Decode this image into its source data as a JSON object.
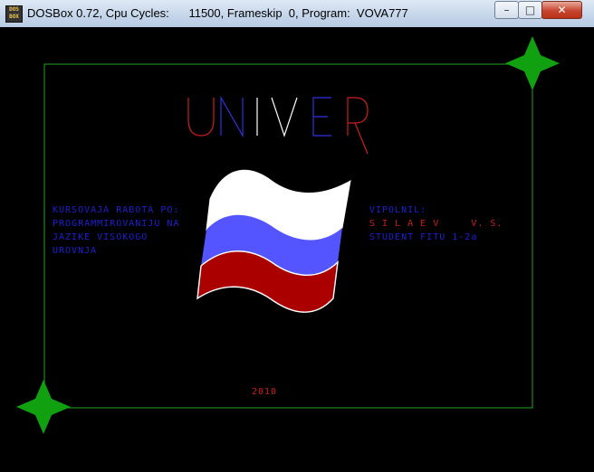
{
  "window": {
    "title": "DOSBox 0.72, Cpu Cycles:      11500, Frameskip  0, Program:  VOVA777",
    "icon_text": "DOS BOX",
    "minimize_icon": "minimize-icon",
    "maximize_icon": "maximize-icon",
    "close_icon": "close-icon"
  },
  "program": {
    "title": "UNIVER",
    "left_lines": [
      "KURSOVAJA RABOTA PO:",
      "PROGRAMMIROVANIJU NA",
      "JAZIKE VISOKOGO",
      "UROVNJA"
    ],
    "right_label": "VIPOLNIL:",
    "author": "S I L A E V     V. S.",
    "student": "STUDENT FITU 1-2a",
    "year": "2010"
  },
  "colors": {
    "frame": "#1fa51f",
    "star": "#10a010",
    "blue_text": "#1f1fd6",
    "red_text": "#cc1d1d",
    "flag_white": "#ffffff",
    "flag_blue": "#5555ff",
    "flag_red": "#aa0000"
  }
}
